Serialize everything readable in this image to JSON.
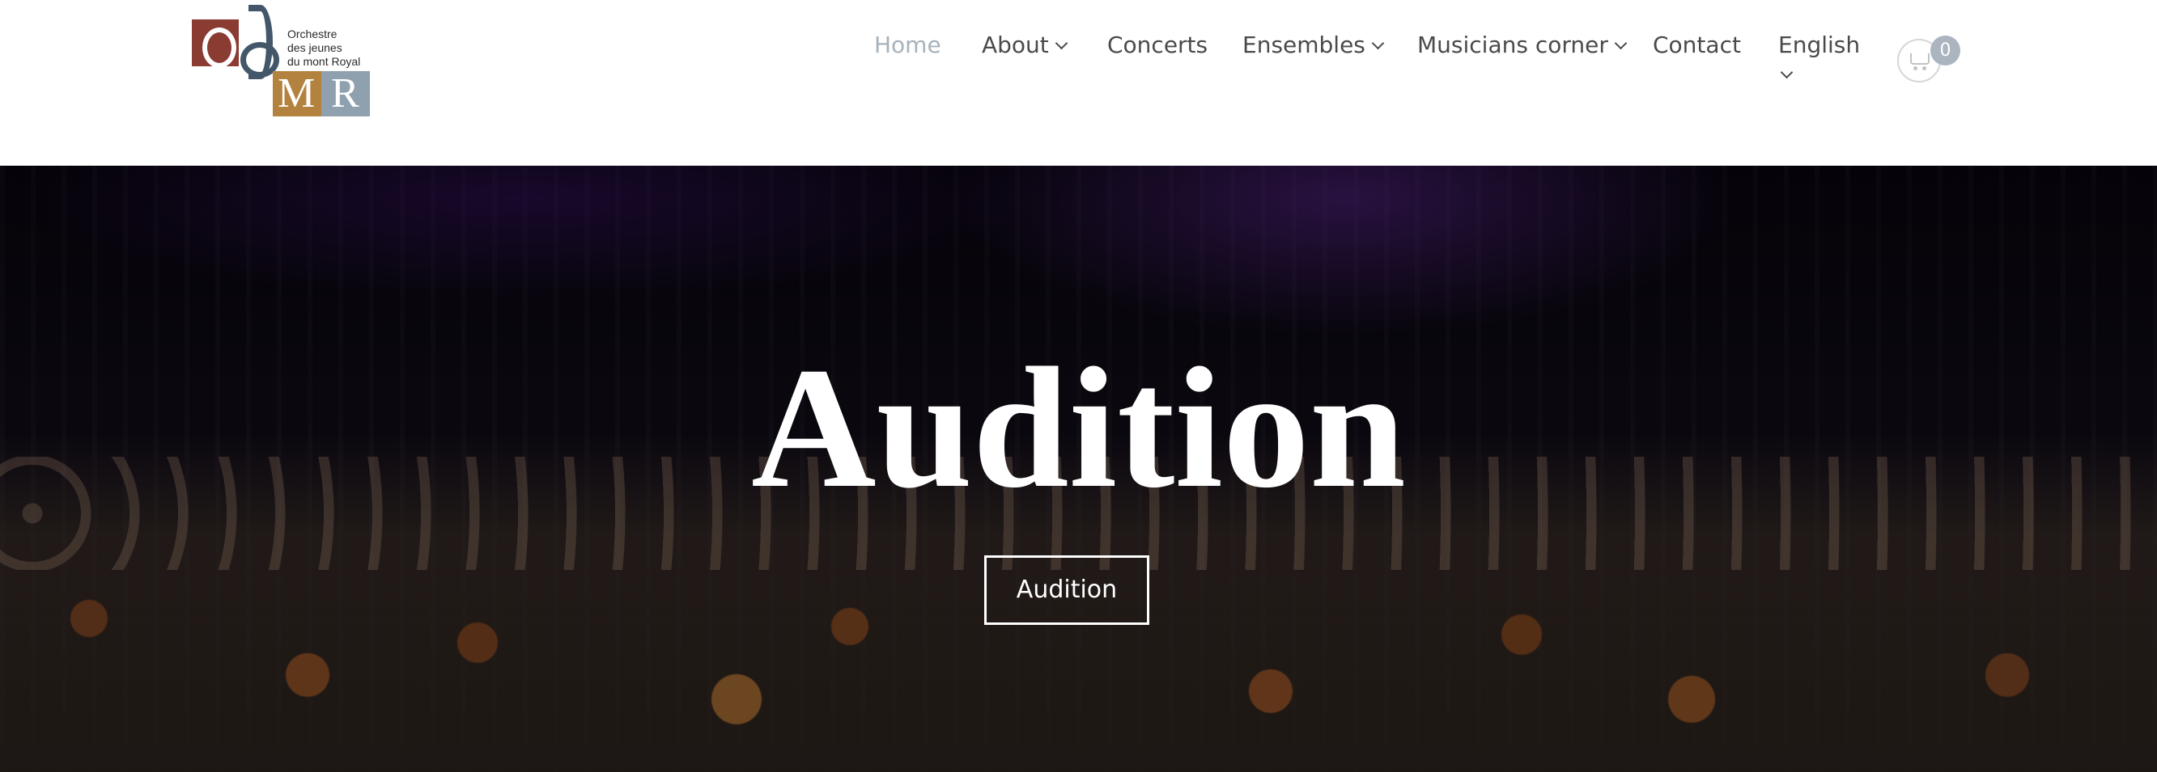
{
  "logo": {
    "name_lines": [
      "Orchestre",
      "des jeunes",
      "du mont Royal"
    ]
  },
  "nav": {
    "items": [
      {
        "label": "Home",
        "active": true,
        "dropdown": false
      },
      {
        "label": "About",
        "active": false,
        "dropdown": true
      },
      {
        "label": "Concerts",
        "active": false,
        "dropdown": false
      },
      {
        "label": "Ensembles",
        "active": false,
        "dropdown": true
      },
      {
        "label": "Musicians corner",
        "active": false,
        "dropdown": true
      },
      {
        "label": "Contact",
        "active": false,
        "dropdown": false
      },
      {
        "label": "English",
        "active": false,
        "dropdown": true
      }
    ]
  },
  "cart": {
    "count": "0",
    "icon": "cart-icon"
  },
  "hero": {
    "title": "Audition",
    "button_label": "Audition"
  },
  "colors": {
    "nav_text": "#4a4a4a",
    "nav_active": "#a6b2bc",
    "badge": "#aab5c0",
    "logo_red": "#8a3b32",
    "logo_blue": "#43566a",
    "logo_gold": "#b4823f",
    "logo_grey": "#8fa0ae"
  }
}
